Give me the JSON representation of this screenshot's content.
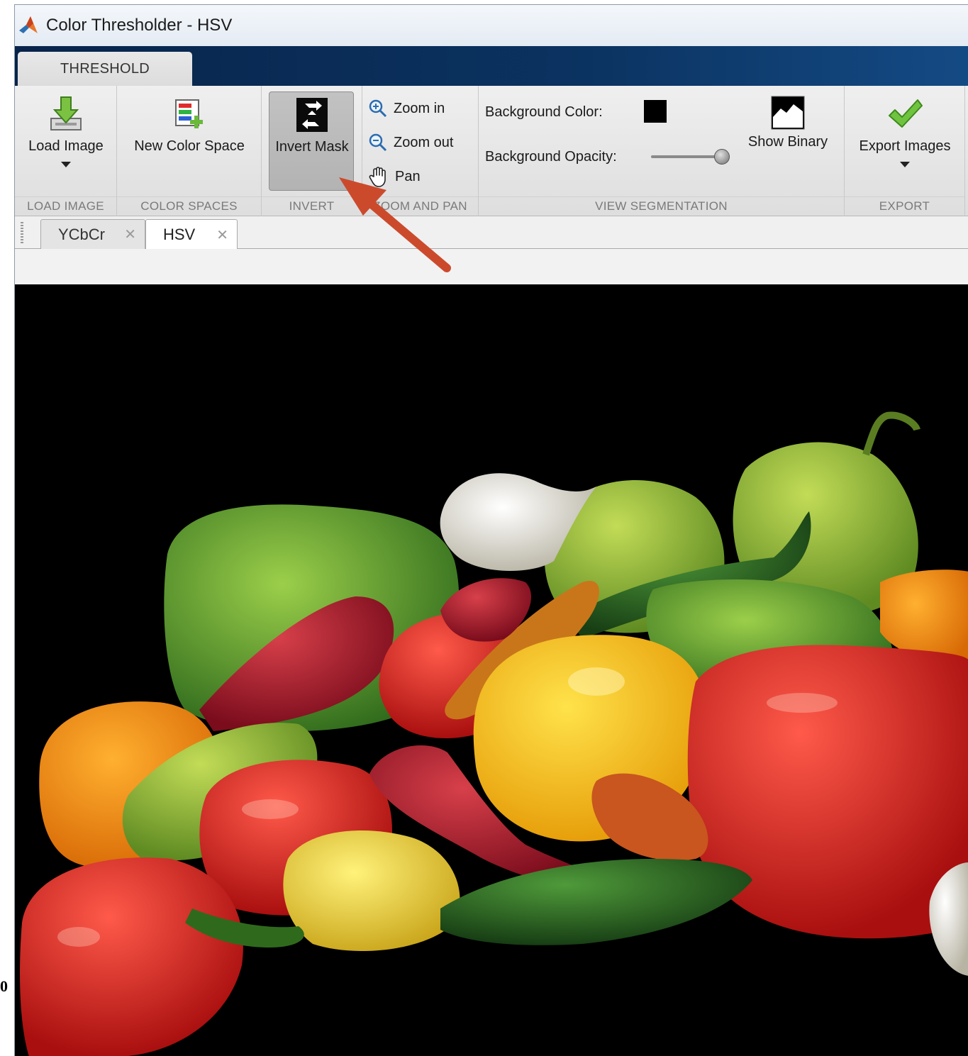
{
  "window": {
    "title": "Color Thresholder - HSV"
  },
  "ribbon_tab": {
    "label": "THRESHOLD"
  },
  "groups": {
    "load_image": {
      "label": "LOAD IMAGE",
      "button": "Load Image"
    },
    "color_spaces": {
      "label": "COLOR SPACES",
      "button": "New Color Space"
    },
    "invert": {
      "label": "INVERT",
      "button": "Invert Mask"
    },
    "zoom_and_pan": {
      "label": "ZOOM AND PAN",
      "zoom_in": "Zoom in",
      "zoom_out": "Zoom out",
      "pan": "Pan"
    },
    "view_segmentation": {
      "label": "VIEW SEGMENTATION",
      "background_color_label": "Background Color:",
      "background_color": "#000000",
      "background_opacity_label": "Background Opacity:",
      "background_opacity": 1.0,
      "show_binary": "Show Binary"
    },
    "export": {
      "label": "EXPORT",
      "button": "Export Images"
    }
  },
  "document_tabs": [
    {
      "label": "YCbCr",
      "active": false
    },
    {
      "label": "HSV",
      "active": true
    }
  ],
  "stray_text": "0",
  "annotation": {
    "type": "arrow",
    "color": "#cc4a2c",
    "points_to": "Invert Mask"
  },
  "image": {
    "subject": "segmented peppers",
    "background": "#000000"
  }
}
